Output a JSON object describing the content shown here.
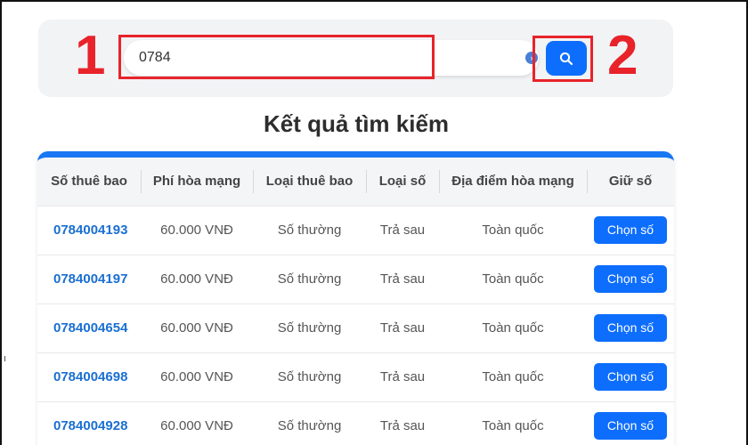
{
  "search": {
    "value": "0784",
    "button_icon": "search-icon"
  },
  "annotations": {
    "label_1": "1",
    "label_2": "2",
    "color": "#e8232a"
  },
  "results": {
    "title": "Kết quả tìm kiếm"
  },
  "table": {
    "columns": [
      "Số thuê bao",
      "Phí hòa mạng",
      "Loại thuê bao",
      "Loại số",
      "Địa điểm hòa mạng",
      "Giữ số"
    ],
    "rows": [
      {
        "number": "0784004193",
        "fee": "60.000 VNĐ",
        "sub_type": "Số thường",
        "num_type": "Trả sau",
        "location": "Toàn quốc",
        "action": "Chọn số"
      },
      {
        "number": "0784004197",
        "fee": "60.000 VNĐ",
        "sub_type": "Số thường",
        "num_type": "Trả sau",
        "location": "Toàn quốc",
        "action": "Chọn số"
      },
      {
        "number": "0784004654",
        "fee": "60.000 VNĐ",
        "sub_type": "Số thường",
        "num_type": "Trả sau",
        "location": "Toàn quốc",
        "action": "Chọn số"
      },
      {
        "number": "0784004698",
        "fee": "60.000 VNĐ",
        "sub_type": "Số thường",
        "num_type": "Trả sau",
        "location": "Toàn quốc",
        "action": "Chọn số"
      },
      {
        "number": "0784004928",
        "fee": "60.000 VNĐ",
        "sub_type": "Số thường",
        "num_type": "Trả sau",
        "location": "Toàn quốc",
        "action": "Chọn số"
      }
    ]
  },
  "colors": {
    "accent": "#1877f2",
    "button": "#0d6efd",
    "number_text": "#1a6fd1"
  }
}
